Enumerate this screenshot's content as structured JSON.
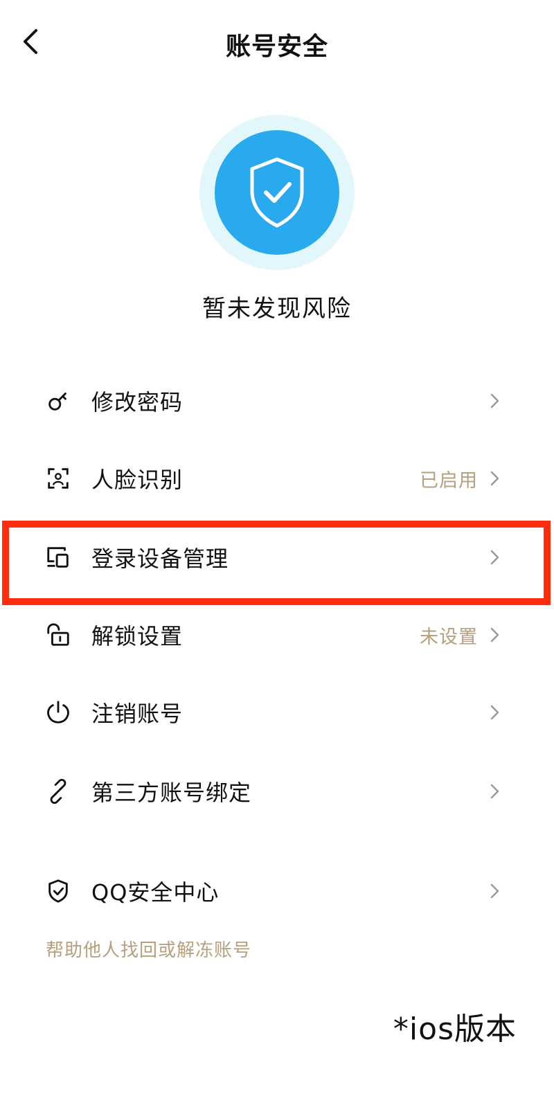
{
  "header": {
    "title": "账号安全",
    "back_icon": "chevron-left-icon"
  },
  "hero": {
    "status_text": "暂未发现风险",
    "icon": "shield-check-icon",
    "colors": {
      "outer": "#e2f7fb",
      "inner": "#29a9ee"
    }
  },
  "menu": {
    "items": [
      {
        "label": "修改密码",
        "status": "",
        "icon": "key-icon"
      },
      {
        "label": "人脸识别",
        "status": "已启用",
        "icon": "face-scan-icon"
      },
      {
        "label": "登录设备管理",
        "status": "",
        "icon": "devices-icon"
      },
      {
        "label": "解锁设置",
        "status": "未设置",
        "icon": "unlock-icon"
      },
      {
        "label": "注销账号",
        "status": "",
        "icon": "power-icon"
      },
      {
        "label": "第三方账号绑定",
        "status": "",
        "icon": "link-icon"
      },
      {
        "label": "QQ安全中心",
        "status": "",
        "icon": "shield-icon"
      }
    ]
  },
  "help_link": "帮助他人找回或解冻账号",
  "version_note": "*ios版本",
  "colors": {
    "accent_text": "#b59f7c",
    "highlight": "#ff2d10"
  }
}
